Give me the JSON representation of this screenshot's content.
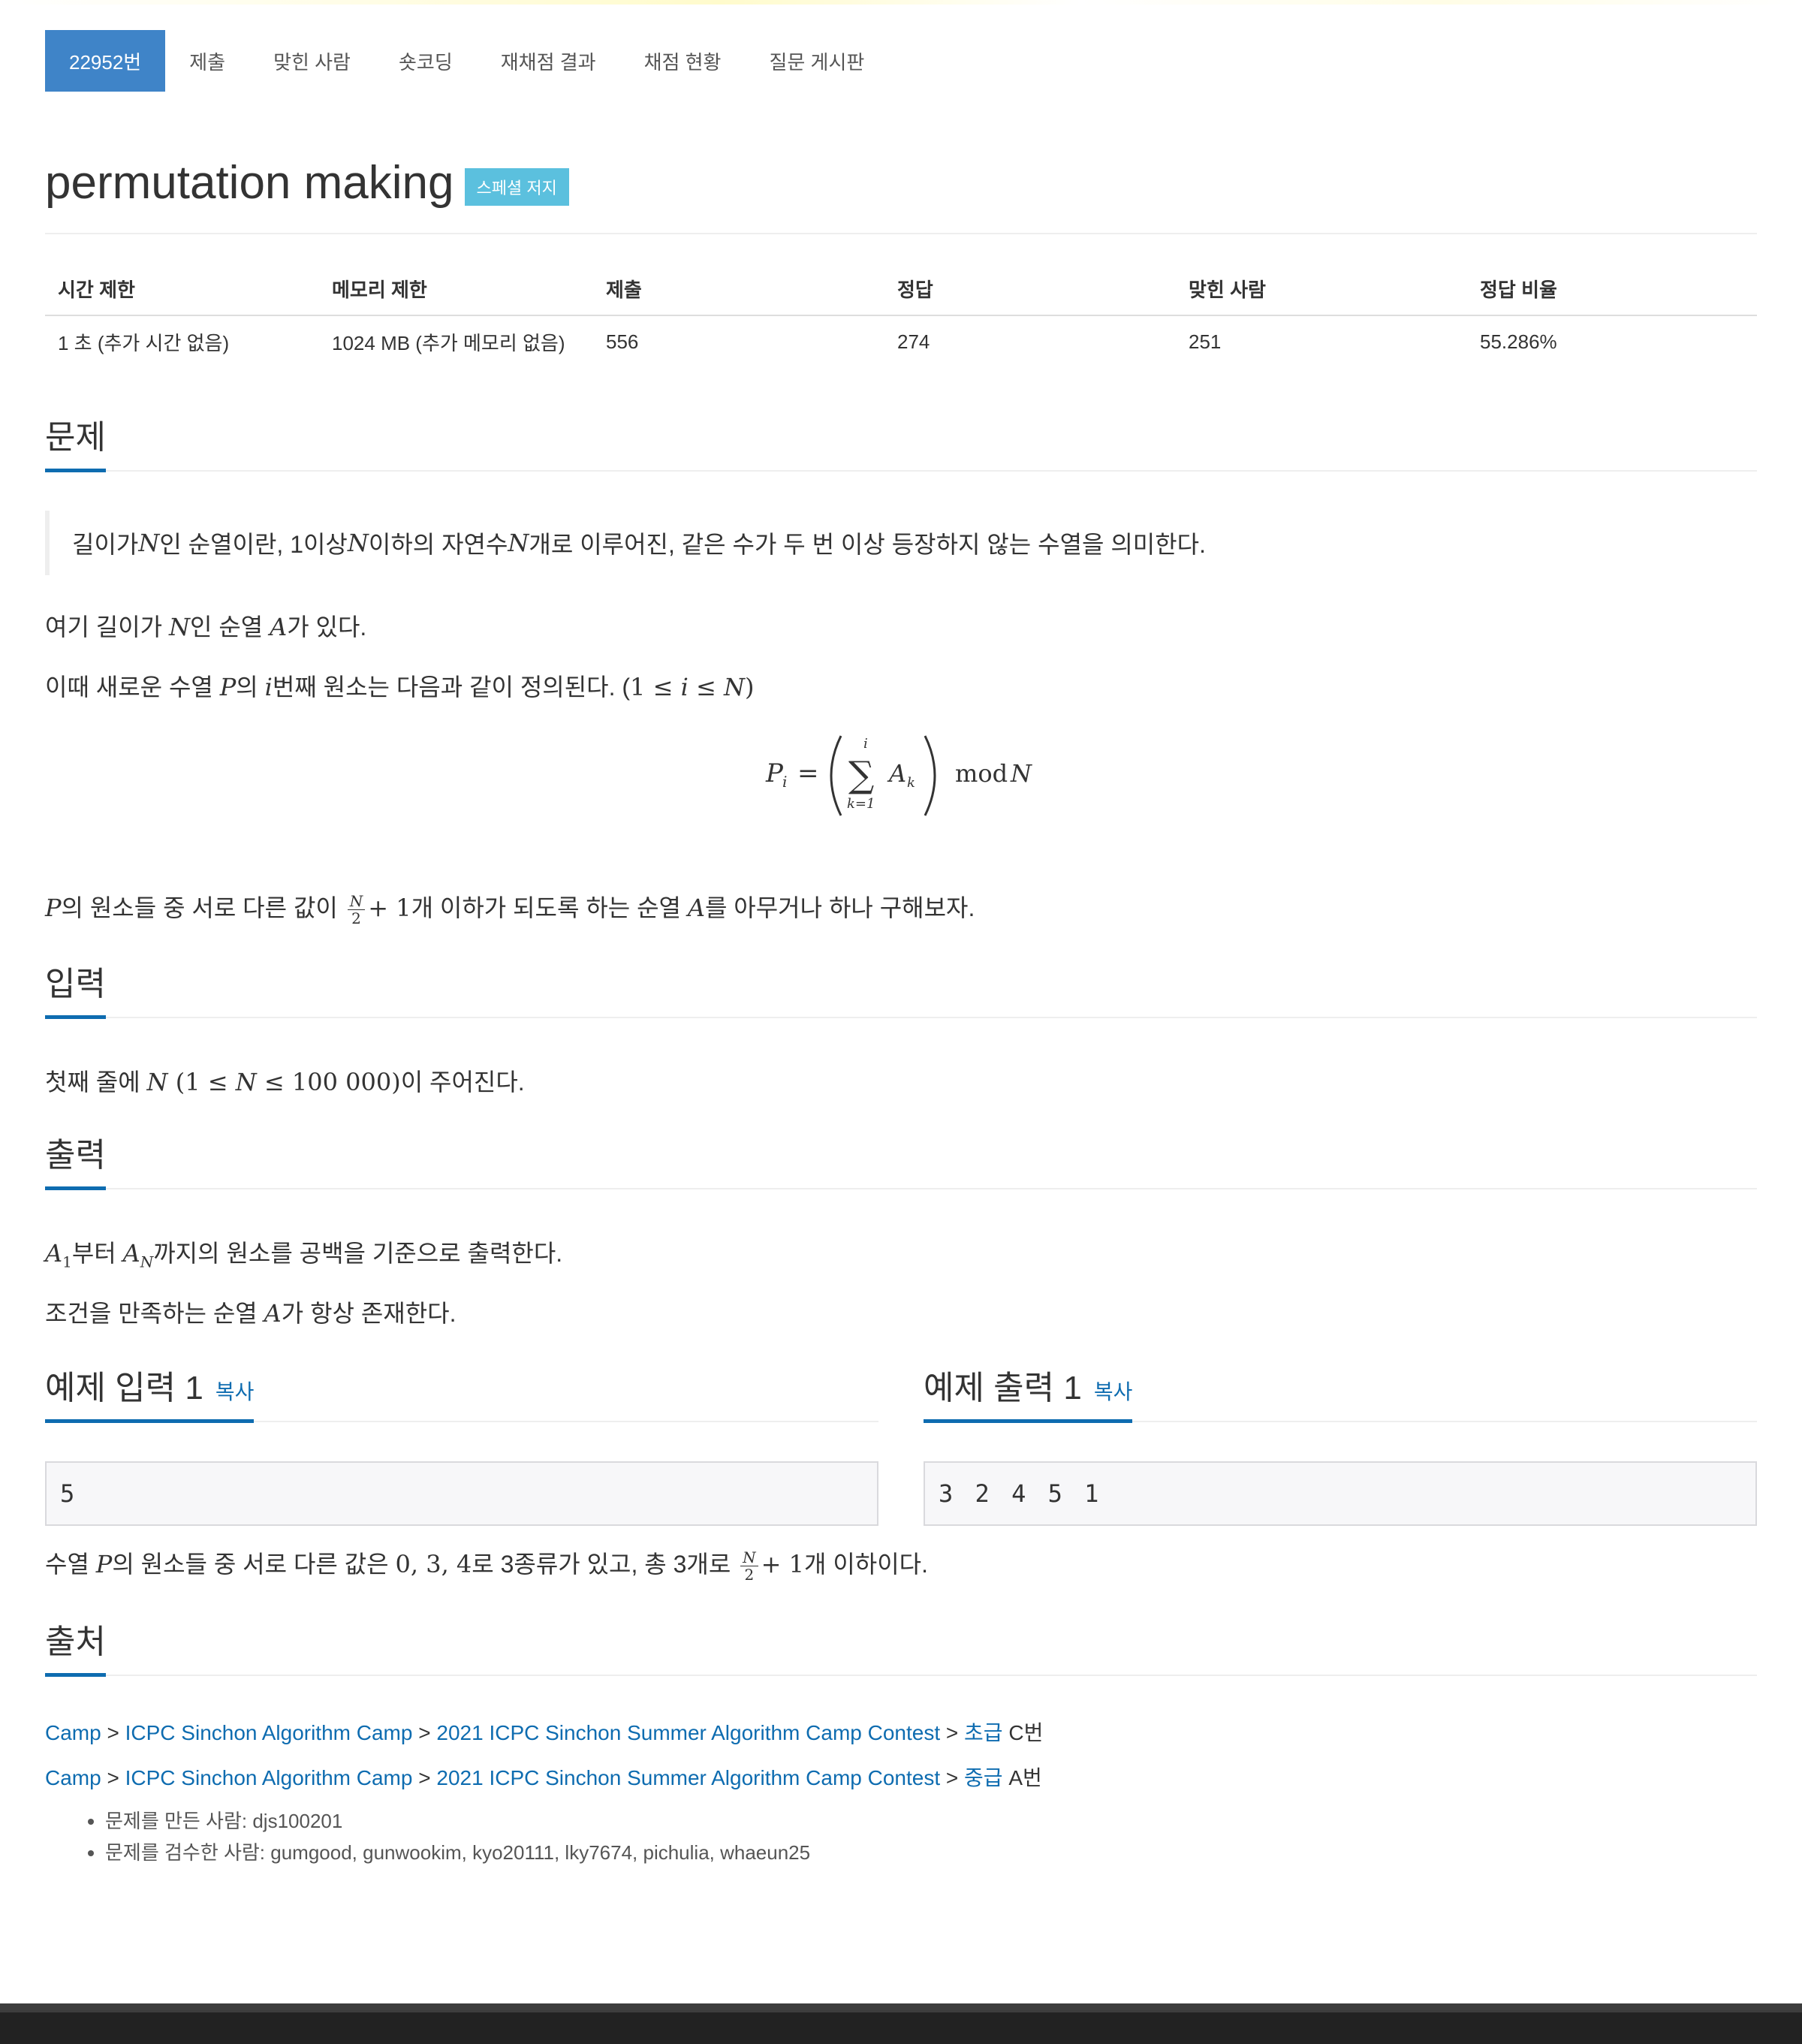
{
  "tabs": [
    {
      "label": "22952번"
    },
    {
      "label": "제출"
    },
    {
      "label": "맞힌 사람"
    },
    {
      "label": "숏코딩"
    },
    {
      "label": "재채점 결과"
    },
    {
      "label": "채점 현황"
    },
    {
      "label": "질문 게시판"
    }
  ],
  "problem": {
    "title": "permutation making",
    "badge": "스페셜 저지"
  },
  "info": {
    "headers": [
      "시간 제한",
      "메모리 제한",
      "제출",
      "정답",
      "맞힌 사람",
      "정답 비율"
    ],
    "values": [
      "1 초 (추가 시간 없음)",
      "1024 MB (추가 메모리 없음)",
      "556",
      "274",
      "251",
      "55.286%"
    ]
  },
  "sections": {
    "problem": "문제",
    "input": "입력",
    "output": "출력",
    "sample_input": "예제 입력 1",
    "sample_output": "예제 출력 1",
    "copy": "복사",
    "source": "출처"
  },
  "text": {
    "quote_a": "길이가 ",
    "quote_b": "인 순열이란, 1이상 ",
    "quote_c": "이하의 자연수 ",
    "quote_d": "개로 이루어진, 같은 수가 두 번 이상 등장하지 않는 수열을 의미한다.",
    "p1_a": "여기 길이가 ",
    "p1_b": "인 순열 ",
    "p1_c": "가 있다.",
    "p2_a": "이때 새로운 수열 ",
    "p2_b": "의 ",
    "p2_c": "번째 원소는 다음과 같이 정의된다. (",
    "p3_a": "의 원소들 중 서로 다른 값이 ",
    "p3_b": "개 이하가 되도록 하는 순열 ",
    "p3_c": "를 아무거나 하나 구해보자.",
    "in_a": "첫째 줄에 ",
    "in_b": "이 주어진다.",
    "out1_a": "부터 ",
    "out1_b": "까지의 원소를 공백을 기준으로 출력한다.",
    "out2_a": "조건을 만족하는 순열 ",
    "out2_b": "가 항상 존재한다.",
    "note_a": "수열 ",
    "note_b": "의 원소들 중 서로 다른 값은 ",
    "note_c": "로 3종류가 있고, 총 3개로 ",
    "note_d": "개 이하이다."
  },
  "samples": {
    "input": "5",
    "output": "3 2 4 5 1"
  },
  "source": {
    "line1": [
      "Camp",
      "ICPC Sinchon Algorithm Camp",
      "2021 ICPC Sinchon Summer Algorithm Camp Contest",
      "초급"
    ],
    "line1_suffix": " C번",
    "line2": [
      "Camp",
      "ICPC Sinchon Algorithm Camp",
      "2021 ICPC Sinchon Summer Algorithm Camp Contest",
      "중급"
    ],
    "line2_suffix": " A번",
    "sep": " > "
  },
  "credits": [
    "문제를 만든 사람: djs100201",
    "문제를 검수한 사람: gumgood, gunwookim, kyo20111, lky7674, pichulia, whaeun25"
  ],
  "colors": {
    "accent": "#3f84c8",
    "link": "#0e6cb0",
    "badge": "#5bc0de"
  }
}
